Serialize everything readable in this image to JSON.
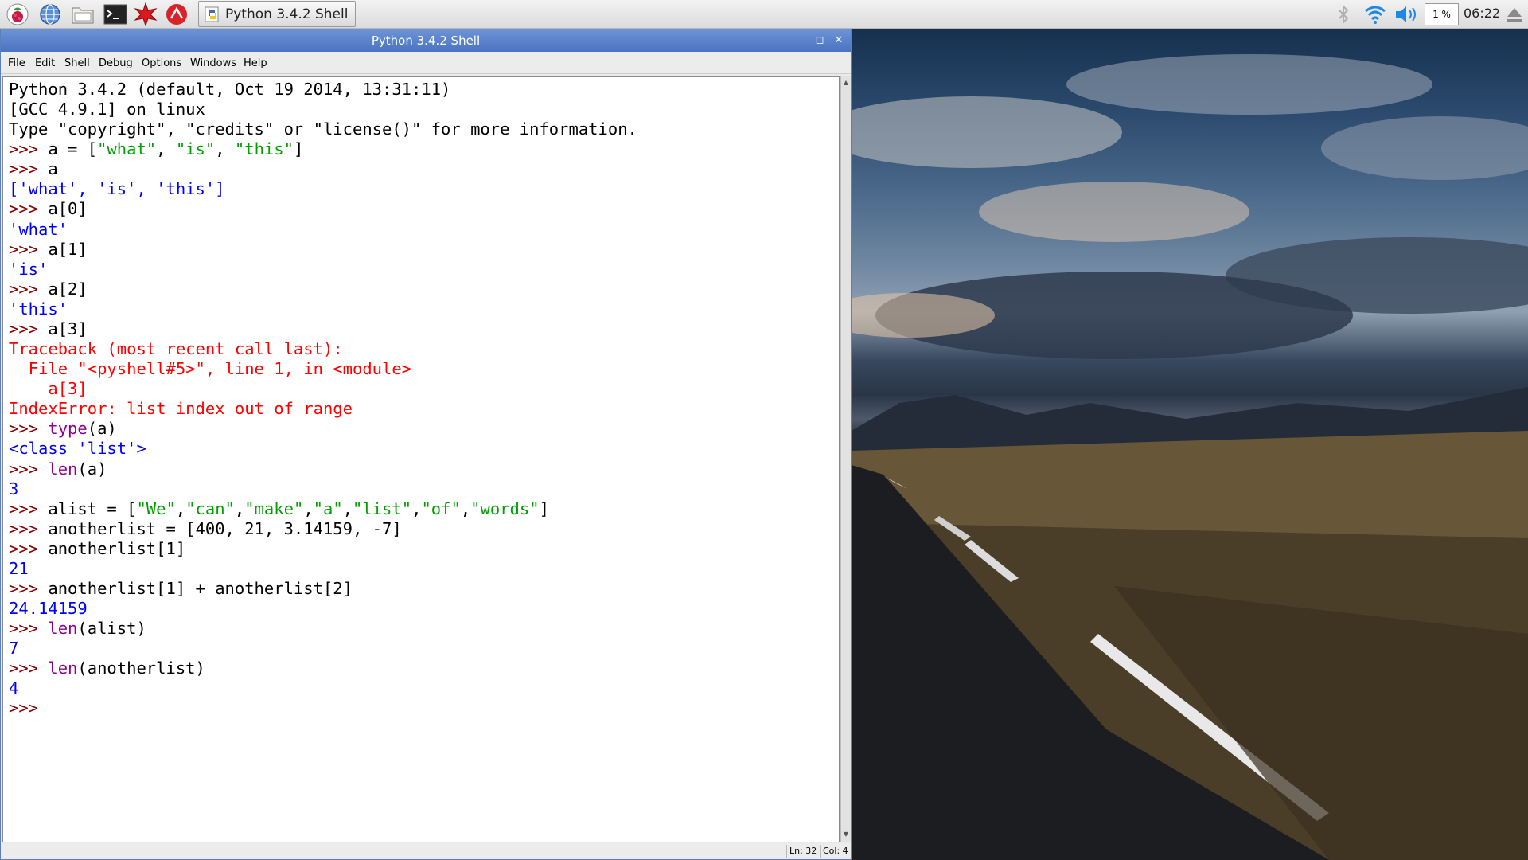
{
  "taskbar": {
    "launchers": [
      {
        "name": "raspberry-menu-icon"
      },
      {
        "name": "web-browser-icon"
      },
      {
        "name": "file-manager-icon"
      },
      {
        "name": "terminal-icon"
      },
      {
        "name": "math-kernel-icon"
      },
      {
        "name": "wolfram-icon"
      }
    ],
    "task": {
      "label": "Python 3.4.2 Shell"
    },
    "cpu_label": "1 %",
    "clock": "06:22",
    "tray_icons": [
      "bluetooth-icon",
      "wifi-icon",
      "volume-icon",
      "eject-icon"
    ]
  },
  "window": {
    "title": "Python 3.4.2 Shell",
    "controls": [
      "_",
      "◻",
      "✕"
    ],
    "menus": [
      "File",
      "Edit",
      "Shell",
      "Debug",
      "Options",
      "Windows",
      "Help"
    ],
    "status": {
      "line": "Ln: 32",
      "col": "Col: 4"
    }
  },
  "shell_lines": [
    [
      [
        "k",
        "Python 3.4.2 (default, Oct 19 2014, 13:31:11)"
      ]
    ],
    [
      [
        "k",
        "[GCC 4.9.1] on linux"
      ]
    ],
    [
      [
        "k",
        "Type \"copyright\", \"credits\" or \"license()\" for more information."
      ]
    ],
    [
      [
        "p",
        ">>> "
      ],
      [
        "k",
        "a = ["
      ],
      [
        "s",
        "\"what\""
      ],
      [
        "k",
        ", "
      ],
      [
        "s",
        "\"is\""
      ],
      [
        "k",
        ", "
      ],
      [
        "s",
        "\"this\""
      ],
      [
        "k",
        "]"
      ]
    ],
    [
      [
        "p",
        ">>> "
      ],
      [
        "k",
        "a"
      ]
    ],
    [
      [
        "o",
        "['what', 'is', 'this']"
      ]
    ],
    [
      [
        "p",
        ">>> "
      ],
      [
        "k",
        "a[0]"
      ]
    ],
    [
      [
        "o",
        "'what'"
      ]
    ],
    [
      [
        "p",
        ">>> "
      ],
      [
        "k",
        "a[1]"
      ]
    ],
    [
      [
        "o",
        "'is'"
      ]
    ],
    [
      [
        "p",
        ">>> "
      ],
      [
        "k",
        "a[2]"
      ]
    ],
    [
      [
        "o",
        "'this'"
      ]
    ],
    [
      [
        "p",
        ">>> "
      ],
      [
        "k",
        "a[3]"
      ]
    ],
    [
      [
        "e",
        "Traceback (most recent call last):"
      ]
    ],
    [
      [
        "e",
        "  File \"<pyshell#5>\", line 1, in <module>"
      ]
    ],
    [
      [
        "e",
        "    a[3]"
      ]
    ],
    [
      [
        "e",
        "IndexError: list index out of range"
      ]
    ],
    [
      [
        "p",
        ">>> "
      ],
      [
        "b",
        "type"
      ],
      [
        "k",
        "(a)"
      ]
    ],
    [
      [
        "o",
        "<class 'list'>"
      ]
    ],
    [
      [
        "p",
        ">>> "
      ],
      [
        "b",
        "len"
      ],
      [
        "k",
        "(a)"
      ]
    ],
    [
      [
        "o",
        "3"
      ]
    ],
    [
      [
        "p",
        ">>> "
      ],
      [
        "k",
        "alist = ["
      ],
      [
        "s",
        "\"We\""
      ],
      [
        "k",
        ","
      ],
      [
        "s",
        "\"can\""
      ],
      [
        "k",
        ","
      ],
      [
        "s",
        "\"make\""
      ],
      [
        "k",
        ","
      ],
      [
        "s",
        "\"a\""
      ],
      [
        "k",
        ","
      ],
      [
        "s",
        "\"list\""
      ],
      [
        "k",
        ","
      ],
      [
        "s",
        "\"of\""
      ],
      [
        "k",
        ","
      ],
      [
        "s",
        "\"words\""
      ],
      [
        "k",
        "]"
      ]
    ],
    [
      [
        "p",
        ">>> "
      ],
      [
        "k",
        "anotherlist = [400, 21, 3.14159, -7]"
      ]
    ],
    [
      [
        "p",
        ">>> "
      ],
      [
        "k",
        "anotherlist[1]"
      ]
    ],
    [
      [
        "o",
        "21"
      ]
    ],
    [
      [
        "p",
        ">>> "
      ],
      [
        "k",
        "anotherlist[1] + anotherlist[2]"
      ]
    ],
    [
      [
        "o",
        "24.14159"
      ]
    ],
    [
      [
        "p",
        ">>> "
      ],
      [
        "b",
        "len"
      ],
      [
        "k",
        "(alist)"
      ]
    ],
    [
      [
        "o",
        "7"
      ]
    ],
    [
      [
        "p",
        ">>> "
      ],
      [
        "b",
        "len"
      ],
      [
        "k",
        "(anotherlist)"
      ]
    ],
    [
      [
        "o",
        "4"
      ]
    ],
    [
      [
        "p",
        ">>> "
      ]
    ]
  ]
}
